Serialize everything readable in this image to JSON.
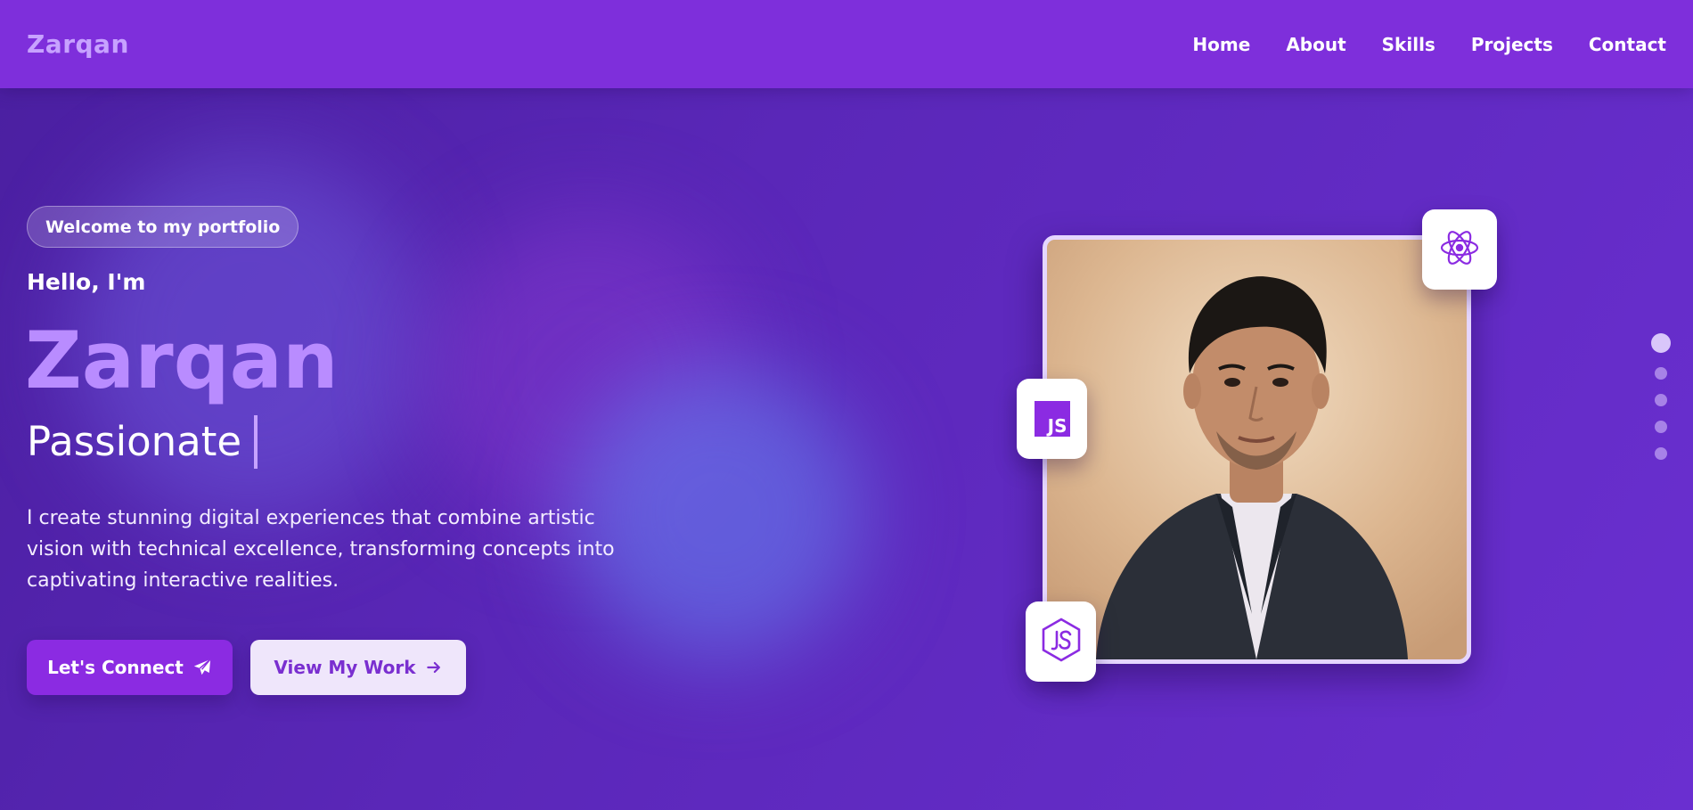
{
  "header": {
    "brand": "Zarqan",
    "nav": [
      "Home",
      "About",
      "Skills",
      "Projects",
      "Contact"
    ]
  },
  "hero": {
    "badge": "Welcome to my portfolio",
    "greeting": "Hello, I'm",
    "name": "Zarqan",
    "typed": "Passionate",
    "description": "I create stunning digital experiences that combine artistic vision with technical excellence, transforming concepts into captivating interactive realities.",
    "cta_primary": "Let's Connect",
    "cta_secondary": "View My Work"
  },
  "tech_cards": {
    "react": "react-icon",
    "javascript": "javascript-icon",
    "js_letters": "JS",
    "node": "nodejs-icon"
  },
  "section_dots": {
    "count": 5,
    "active_index": 0
  },
  "colors": {
    "navbar": "#7e2fdb",
    "accent": "#8b2be2",
    "name_highlight": "#b98cff",
    "background": "#5a27b8"
  }
}
